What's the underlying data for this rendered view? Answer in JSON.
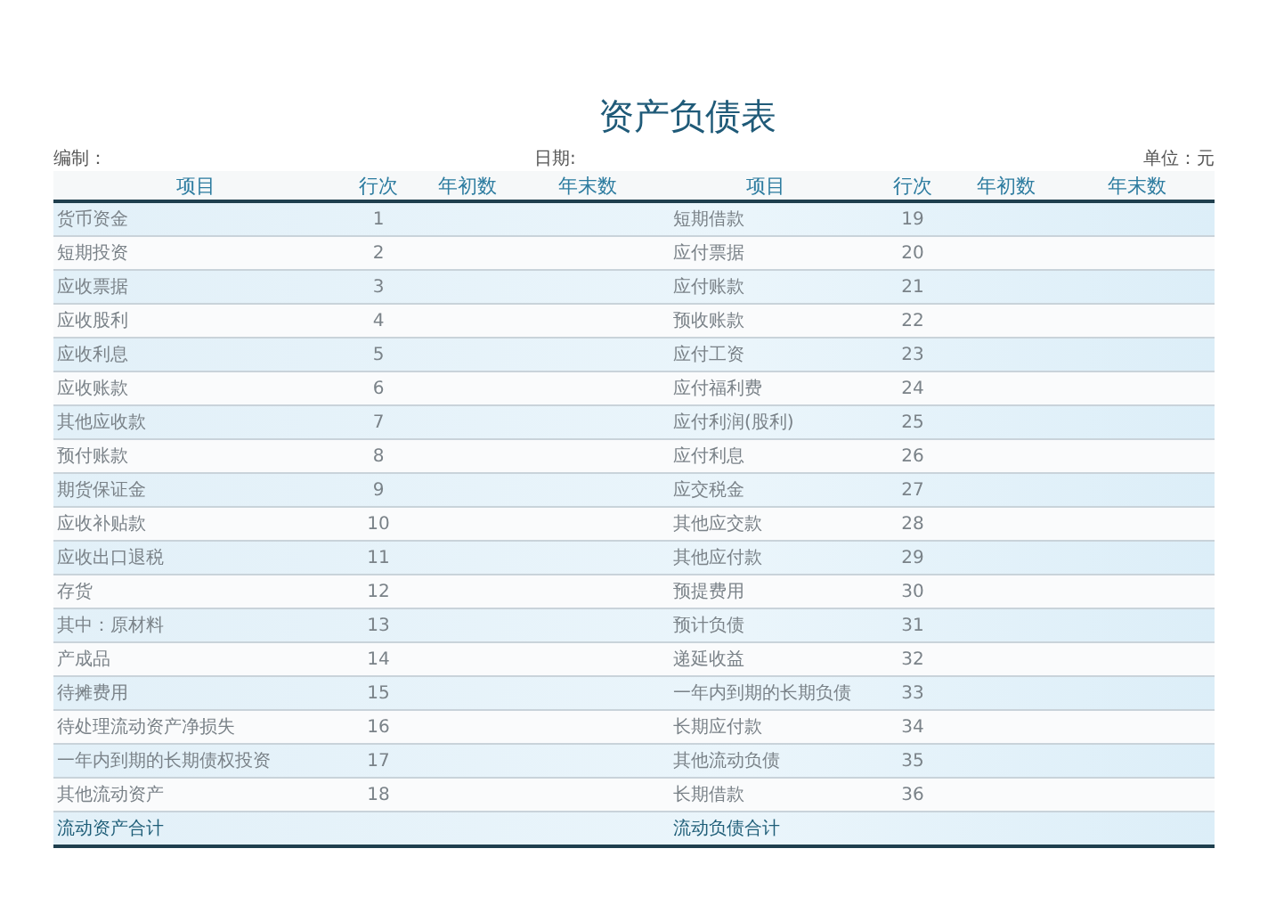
{
  "title": "资产负债表",
  "meta": {
    "prepared_by": "编制：",
    "date": "日期:",
    "unit": "单位：元"
  },
  "columns": [
    "项目",
    "行次",
    "年初数",
    "年末数",
    "项目",
    "行次",
    "年初数",
    "年末数"
  ],
  "rows": [
    {
      "kind": "item",
      "left": {
        "item": "货币资金",
        "line": "1"
      },
      "right": {
        "item": "短期借款",
        "line": "19"
      }
    },
    {
      "kind": "item",
      "left": {
        "item": "短期投资",
        "line": "2"
      },
      "right": {
        "item": "应付票据",
        "line": "20"
      }
    },
    {
      "kind": "item",
      "left": {
        "item": "应收票据",
        "line": "3"
      },
      "right": {
        "item": "应付账款",
        "line": "21"
      }
    },
    {
      "kind": "item",
      "left": {
        "item": "应收股利",
        "line": "4"
      },
      "right": {
        "item": "预收账款",
        "line": "22"
      }
    },
    {
      "kind": "item",
      "left": {
        "item": "应收利息",
        "line": "5"
      },
      "right": {
        "item": "应付工资",
        "line": "23"
      }
    },
    {
      "kind": "item",
      "left": {
        "item": "应收账款",
        "line": "6"
      },
      "right": {
        "item": "应付福利费",
        "line": "24"
      }
    },
    {
      "kind": "item",
      "left": {
        "item": "其他应收款",
        "line": "7"
      },
      "right": {
        "item": "应付利润(股利)",
        "line": "25"
      }
    },
    {
      "kind": "item",
      "left": {
        "item": "预付账款",
        "line": "8"
      },
      "right": {
        "item": "应付利息",
        "line": "26"
      }
    },
    {
      "kind": "item",
      "left": {
        "item": "期货保证金",
        "line": "9"
      },
      "right": {
        "item": "应交税金",
        "line": "27"
      }
    },
    {
      "kind": "item",
      "left": {
        "item": "应收补贴款",
        "line": "10"
      },
      "right": {
        "item": "其他应交款",
        "line": "28"
      }
    },
    {
      "kind": "item",
      "left": {
        "item": "应收出口退税",
        "line": "11"
      },
      "right": {
        "item": "其他应付款",
        "line": "29"
      }
    },
    {
      "kind": "item",
      "left": {
        "item": "存货",
        "line": "12"
      },
      "right": {
        "item": "预提费用",
        "line": "30"
      }
    },
    {
      "kind": "item",
      "left": {
        "item": "其中：原材料",
        "line": "13"
      },
      "right": {
        "item": "预计负债",
        "line": "31"
      }
    },
    {
      "kind": "item",
      "left": {
        "item": "产成品",
        "line": "14"
      },
      "right": {
        "item": "递延收益",
        "line": "32"
      }
    },
    {
      "kind": "item",
      "left": {
        "item": "待摊费用",
        "line": "15"
      },
      "right": {
        "item": "一年内到期的长期负债",
        "line": "33"
      }
    },
    {
      "kind": "item",
      "left": {
        "item": "待处理流动资产净损失",
        "line": "16"
      },
      "right": {
        "item": "长期应付款",
        "line": "34"
      }
    },
    {
      "kind": "item",
      "left": {
        "item": "一年内到期的长期债权投资",
        "line": "17"
      },
      "right": {
        "item": "其他流动负债",
        "line": "35"
      }
    },
    {
      "kind": "item",
      "left": {
        "item": "其他流动资产",
        "line": "18"
      },
      "right": {
        "item": "长期借款",
        "line": "36"
      }
    },
    {
      "kind": "total",
      "left": {
        "item": "流动资产合计"
      },
      "right": {
        "item": "流动负债合计"
      }
    }
  ]
}
